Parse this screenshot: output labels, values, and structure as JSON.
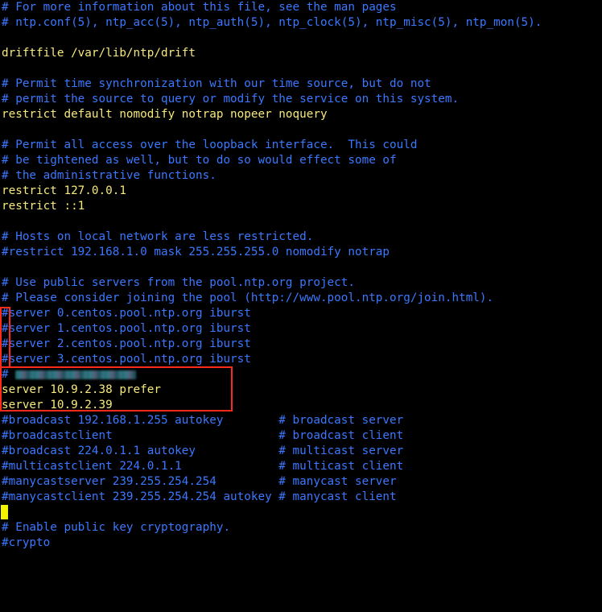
{
  "lines": [
    {
      "text": "# For more information about this file, see the man pages",
      "style": "comment"
    },
    {
      "text": "# ntp.conf(5), ntp_acc(5), ntp_auth(5), ntp_clock(5), ntp_misc(5), ntp_mon(5).",
      "style": "comment"
    },
    {
      "text": "",
      "style": "blank"
    },
    {
      "text": "driftfile /var/lib/ntp/drift",
      "style": "code"
    },
    {
      "text": "",
      "style": "blank"
    },
    {
      "text": "# Permit time synchronization with our time source, but do not",
      "style": "comment"
    },
    {
      "text": "# permit the source to query or modify the service on this system.",
      "style": "comment"
    },
    {
      "text": "restrict default nomodify notrap nopeer noquery",
      "style": "code"
    },
    {
      "text": "",
      "style": "blank"
    },
    {
      "text": "# Permit all access over the loopback interface.  This could",
      "style": "comment"
    },
    {
      "text": "# be tightened as well, but to do so would effect some of",
      "style": "comment"
    },
    {
      "text": "# the administrative functions.",
      "style": "comment"
    },
    {
      "text": "restrict 127.0.0.1",
      "style": "code"
    },
    {
      "text": "restrict ::1",
      "style": "code"
    },
    {
      "text": "",
      "style": "blank"
    },
    {
      "text": "# Hosts on local network are less restricted.",
      "style": "comment"
    },
    {
      "text": "#restrict 192.168.1.0 mask 255.255.255.0 nomodify notrap",
      "style": "comment"
    },
    {
      "text": "",
      "style": "blank"
    },
    {
      "text": "# Use public servers from the pool.ntp.org project.",
      "style": "comment"
    },
    {
      "text": "# Please consider joining the pool (http://www.pool.ntp.org/join.html).",
      "style": "comment"
    },
    {
      "text": "#server 0.centos.pool.ntp.org iburst",
      "style": "comment"
    },
    {
      "text": "#server 1.centos.pool.ntp.org iburst",
      "style": "comment"
    },
    {
      "text": "#server 2.centos.pool.ntp.org iburst",
      "style": "comment"
    },
    {
      "text": "#server 3.centos.pool.ntp.org iburst",
      "style": "comment"
    },
    {
      "text": "#",
      "style": "comment",
      "redacted": true
    },
    {
      "text": "server 10.9.2.38 prefer",
      "style": "code"
    },
    {
      "text": "server 10.9.2.39",
      "style": "code"
    },
    {
      "text": "#broadcast 192.168.1.255 autokey        # broadcast server",
      "style": "comment"
    },
    {
      "text": "#broadcastclient                        # broadcast client",
      "style": "comment"
    },
    {
      "text": "#broadcast 224.0.1.1 autokey            # multicast server",
      "style": "comment"
    },
    {
      "text": "#multicastclient 224.0.1.1              # multicast client",
      "style": "comment"
    },
    {
      "text": "#manycastserver 239.255.254.254         # manycast server",
      "style": "comment"
    },
    {
      "text": "#manycastclient 239.255.254.254 autokey # manycast client",
      "style": "comment"
    },
    {
      "text": "",
      "style": "cursor"
    },
    {
      "text": "# Enable public key cryptography.",
      "style": "comment"
    },
    {
      "text": "#crypto",
      "style": "comment"
    }
  ],
  "colors": {
    "background": "#000000",
    "comment": "#3b78ff",
    "code": "#f7e97b",
    "cursor": "#f4f400",
    "annotation": "#ff2a1a"
  }
}
